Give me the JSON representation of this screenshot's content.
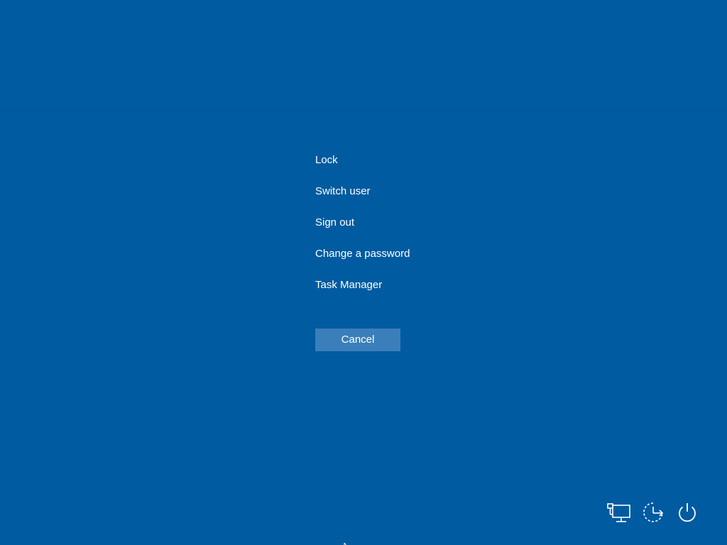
{
  "screen": {
    "background": "#005ba1",
    "accent": "#3a7fba"
  },
  "menu": {
    "items": [
      {
        "label": "Lock"
      },
      {
        "label": "Switch user"
      },
      {
        "label": "Sign out"
      },
      {
        "label": "Change a password"
      },
      {
        "label": "Task Manager"
      }
    ]
  },
  "actions": {
    "cancel_label": "Cancel"
  },
  "tray": {
    "icons": [
      "network-icon",
      "ease-of-access-icon",
      "power-icon"
    ]
  }
}
